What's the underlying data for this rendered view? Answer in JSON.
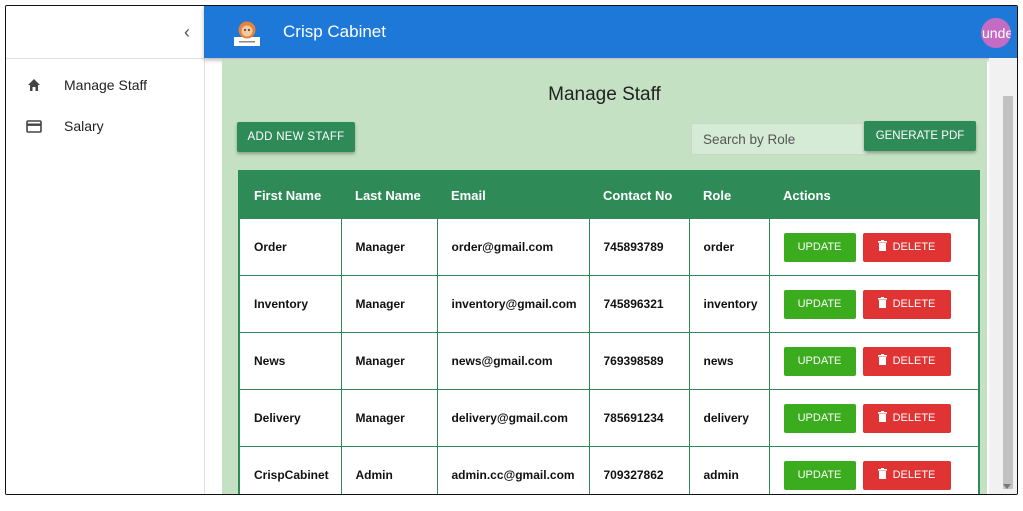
{
  "app": {
    "title": "Crisp Cabinet",
    "avatar_text": "undefined"
  },
  "sidebar": {
    "items": [
      {
        "label": "Manage Staff",
        "icon": "home-icon"
      },
      {
        "label": "Salary",
        "icon": "credit-card-icon"
      }
    ]
  },
  "main": {
    "title": "Manage Staff",
    "add_label": "ADD NEW STAFF",
    "search_placeholder": "Search by Role",
    "pdf_label": "GENERATE PDF"
  },
  "table": {
    "headers": [
      "First Name",
      "Last Name",
      "Email",
      "Contact No",
      "Role",
      "Actions"
    ],
    "rows": [
      [
        "Order",
        "Manager",
        "order@gmail.com",
        "745893789",
        "order"
      ],
      [
        "Inventory",
        "Manager",
        "inventory@gmail.com",
        "745896321",
        "inventory"
      ],
      [
        "News",
        "Manager",
        "news@gmail.com",
        "769398589",
        "news"
      ],
      [
        "Delivery",
        "Manager",
        "delivery@gmail.com",
        "785691234",
        "delivery"
      ],
      [
        "CrispCabinet",
        "Admin",
        "admin.cc@gmail.com",
        "709327862",
        "admin"
      ]
    ],
    "update_label": "UPDATE",
    "delete_label": "DELETE"
  },
  "colors": {
    "appbar": "#1e78d8",
    "primary": "#2e8b57",
    "background": "#c4e1c3",
    "update": "#3aac1e",
    "delete": "#e03434"
  }
}
